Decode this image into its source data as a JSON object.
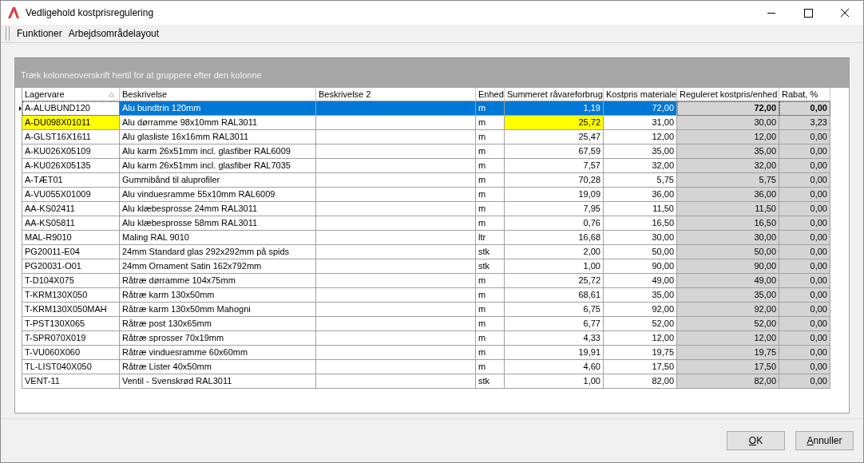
{
  "window": {
    "title": "Vedligehold kostprisregulering"
  },
  "menu": [
    {
      "label": "Funktioner"
    },
    {
      "label": "Arbejdsområdelayout"
    }
  ],
  "group_panel": {
    "hint": "Træk kolonneoverskrift hertil for at gruppere efter den kolonne"
  },
  "table": {
    "columns": [
      {
        "label": "Lagervare",
        "kind": "text",
        "editable": false,
        "sorted": true
      },
      {
        "label": "Beskrivelse",
        "kind": "text",
        "editable": false,
        "sorted": false
      },
      {
        "label": "Beskrivelse 2",
        "kind": "text",
        "editable": false,
        "sorted": false
      },
      {
        "label": "Enhed",
        "kind": "text",
        "editable": false,
        "sorted": false
      },
      {
        "label": "Summeret råvareforbrug",
        "kind": "number",
        "editable": false,
        "sorted": false
      },
      {
        "label": "Kostpris materiale",
        "kind": "number",
        "editable": false,
        "sorted": false
      },
      {
        "label": "Reguleret kostpris/enhed",
        "kind": "number",
        "editable": true,
        "sorted": false
      },
      {
        "label": "Rabat, %",
        "kind": "number",
        "editable": true,
        "sorted": false
      }
    ],
    "rows": [
      {
        "selected": true,
        "flagged": false,
        "cells": [
          "A-ALUBUND120",
          "Alu bundtrin 120mm",
          "",
          "m",
          "1,19",
          "72,00",
          "72,00",
          "0,00"
        ]
      },
      {
        "selected": false,
        "flagged": true,
        "cells": [
          "A-DU098X01011",
          "Alu dørramme 98x10mm RAL3011",
          "",
          "m",
          "25,72",
          "31,00",
          "30,00",
          "3,23"
        ]
      },
      {
        "selected": false,
        "flagged": false,
        "cells": [
          "A-GLST16X1611",
          "Alu glasliste 16x16mm RAL3011",
          "",
          "m",
          "25,47",
          "12,00",
          "12,00",
          "0,00"
        ]
      },
      {
        "selected": false,
        "flagged": false,
        "cells": [
          "A-KU026X05109",
          "Alu karm 26x51mm incl. glasfiber RAL6009",
          "",
          "m",
          "67,59",
          "35,00",
          "35,00",
          "0,00"
        ]
      },
      {
        "selected": false,
        "flagged": false,
        "cells": [
          "A-KU026X05135",
          "Alu karm 26x51mm incl. glasfiber RAL7035",
          "",
          "m",
          "7,57",
          "32,00",
          "32,00",
          "0,00"
        ]
      },
      {
        "selected": false,
        "flagged": false,
        "cells": [
          "A-TÆT01",
          "Gummibånd til aluprofiler",
          "",
          "m",
          "70,28",
          "5,75",
          "5,75",
          "0,00"
        ]
      },
      {
        "selected": false,
        "flagged": false,
        "cells": [
          "A-VU055X01009",
          "Alu vinduesramme 55x10mm RAL6009",
          "",
          "m",
          "19,09",
          "36,00",
          "36,00",
          "0,00"
        ]
      },
      {
        "selected": false,
        "flagged": false,
        "cells": [
          "AA-KS02411",
          "Alu klæbesprosse 24mm RAL3011",
          "",
          "m",
          "7,95",
          "11,50",
          "11,50",
          "0,00"
        ]
      },
      {
        "selected": false,
        "flagged": false,
        "cells": [
          "AA-KS05811",
          "Alu klæbesprosse 58mm RAL3011",
          "",
          "m",
          "0,76",
          "16,50",
          "16,50",
          "0,00"
        ]
      },
      {
        "selected": false,
        "flagged": false,
        "cells": [
          "MAL-R9010",
          "Maling RAL 9010",
          "",
          "ltr",
          "16,68",
          "30,00",
          "30,00",
          "0,00"
        ]
      },
      {
        "selected": false,
        "flagged": false,
        "cells": [
          "PG20011-E04",
          "24mm Standard glas 292x292mm på spids",
          "",
          "stk",
          "2,00",
          "50,00",
          "50,00",
          "0,00"
        ]
      },
      {
        "selected": false,
        "flagged": false,
        "cells": [
          "PG20031-O01",
          "24mm Ornament Satin 162x792mm",
          "",
          "stk",
          "1,00",
          "90,00",
          "90,00",
          "0,00"
        ]
      },
      {
        "selected": false,
        "flagged": false,
        "cells": [
          "T-D104X075",
          "Råtræ dørramme 104x75mm",
          "",
          "m",
          "25,72",
          "49,00",
          "49,00",
          "0,00"
        ]
      },
      {
        "selected": false,
        "flagged": false,
        "cells": [
          "T-KRM130X050",
          "Råtræ karm 130x50mm",
          "",
          "m",
          "68,61",
          "35,00",
          "35,00",
          "0,00"
        ]
      },
      {
        "selected": false,
        "flagged": false,
        "cells": [
          "T-KRM130X050MAH",
          "Råtræ karm 130x50mm Mahogni",
          "",
          "m",
          "6,75",
          "92,00",
          "92,00",
          "0,00"
        ]
      },
      {
        "selected": false,
        "flagged": false,
        "cells": [
          "T-PST130X065",
          "Råtræ post 130x65mm",
          "",
          "m",
          "6,77",
          "52,00",
          "52,00",
          "0,00"
        ]
      },
      {
        "selected": false,
        "flagged": false,
        "cells": [
          "T-SPR070X019",
          "Råtræ sprosser 70x19mm",
          "",
          "m",
          "4,33",
          "12,00",
          "12,00",
          "0,00"
        ]
      },
      {
        "selected": false,
        "flagged": false,
        "cells": [
          "T-VU060X060",
          "Råtræ vinduesramme 60x60mm",
          "",
          "m",
          "19,91",
          "19,75",
          "19,75",
          "0,00"
        ]
      },
      {
        "selected": false,
        "flagged": false,
        "cells": [
          "TL-LIST040X050",
          "Råtræ Lister 40x50mm",
          "",
          "m",
          "4,60",
          "17,50",
          "17,50",
          "0,00"
        ]
      },
      {
        "selected": false,
        "flagged": false,
        "cells": [
          "VENT-11",
          "Ventil - Svenskrød RAL3011",
          "",
          "stk",
          "1,00",
          "82,00",
          "82,00",
          "0,00"
        ]
      }
    ]
  },
  "buttons": [
    {
      "label": "OK"
    },
    {
      "label": "Annuller"
    }
  ]
}
